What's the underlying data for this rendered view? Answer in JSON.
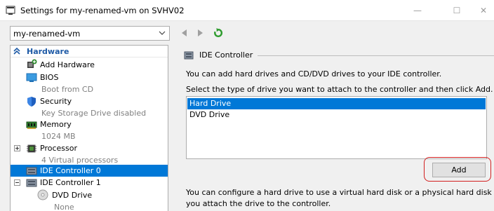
{
  "window": {
    "title": "Settings for my-renamed-vm on SVHV02",
    "minimize": "—",
    "maximize": "☐",
    "close": "✕"
  },
  "vm_selector": {
    "value": "my-renamed-vm"
  },
  "tree": {
    "hardware_label": "Hardware",
    "items": [
      {
        "label": "Add Hardware",
        "icon": "add-hardware-icon"
      },
      {
        "label": "BIOS",
        "sub": "Boot from CD",
        "icon": "bios-icon"
      },
      {
        "label": "Security",
        "sub": "Key Storage Drive disabled",
        "icon": "shield-icon"
      },
      {
        "label": "Memory",
        "sub": "1024 MB",
        "icon": "memory-icon"
      },
      {
        "label": "Processor",
        "sub": "4 Virtual processors",
        "icon": "processor-icon"
      },
      {
        "label": "IDE Controller 0",
        "icon": "ide-controller-icon",
        "selected": true
      },
      {
        "label": "IDE Controller 1",
        "icon": "ide-controller-icon"
      },
      {
        "label": "DVD Drive",
        "sub": "None",
        "icon": "dvd-drive-icon"
      }
    ]
  },
  "main": {
    "heading": "IDE Controller",
    "line1": "You can add hard drives and CD/DVD drives to your IDE controller.",
    "line2": "Select the type of drive you want to attach to the controller and then click Add.",
    "drive_types": [
      "Hard Drive",
      "DVD Drive"
    ],
    "selected_drive": "Hard Drive",
    "add_label": "Add",
    "footer1": "You can configure a hard drive to use a virtual hard disk or a physical hard disk after",
    "footer2": "you attach the drive to the controller."
  },
  "colors": {
    "selection": "#0078d7",
    "highlight": "#d21f1f",
    "refresh": "#2e9c2e",
    "hardware_heading": "#1e5aa6"
  }
}
